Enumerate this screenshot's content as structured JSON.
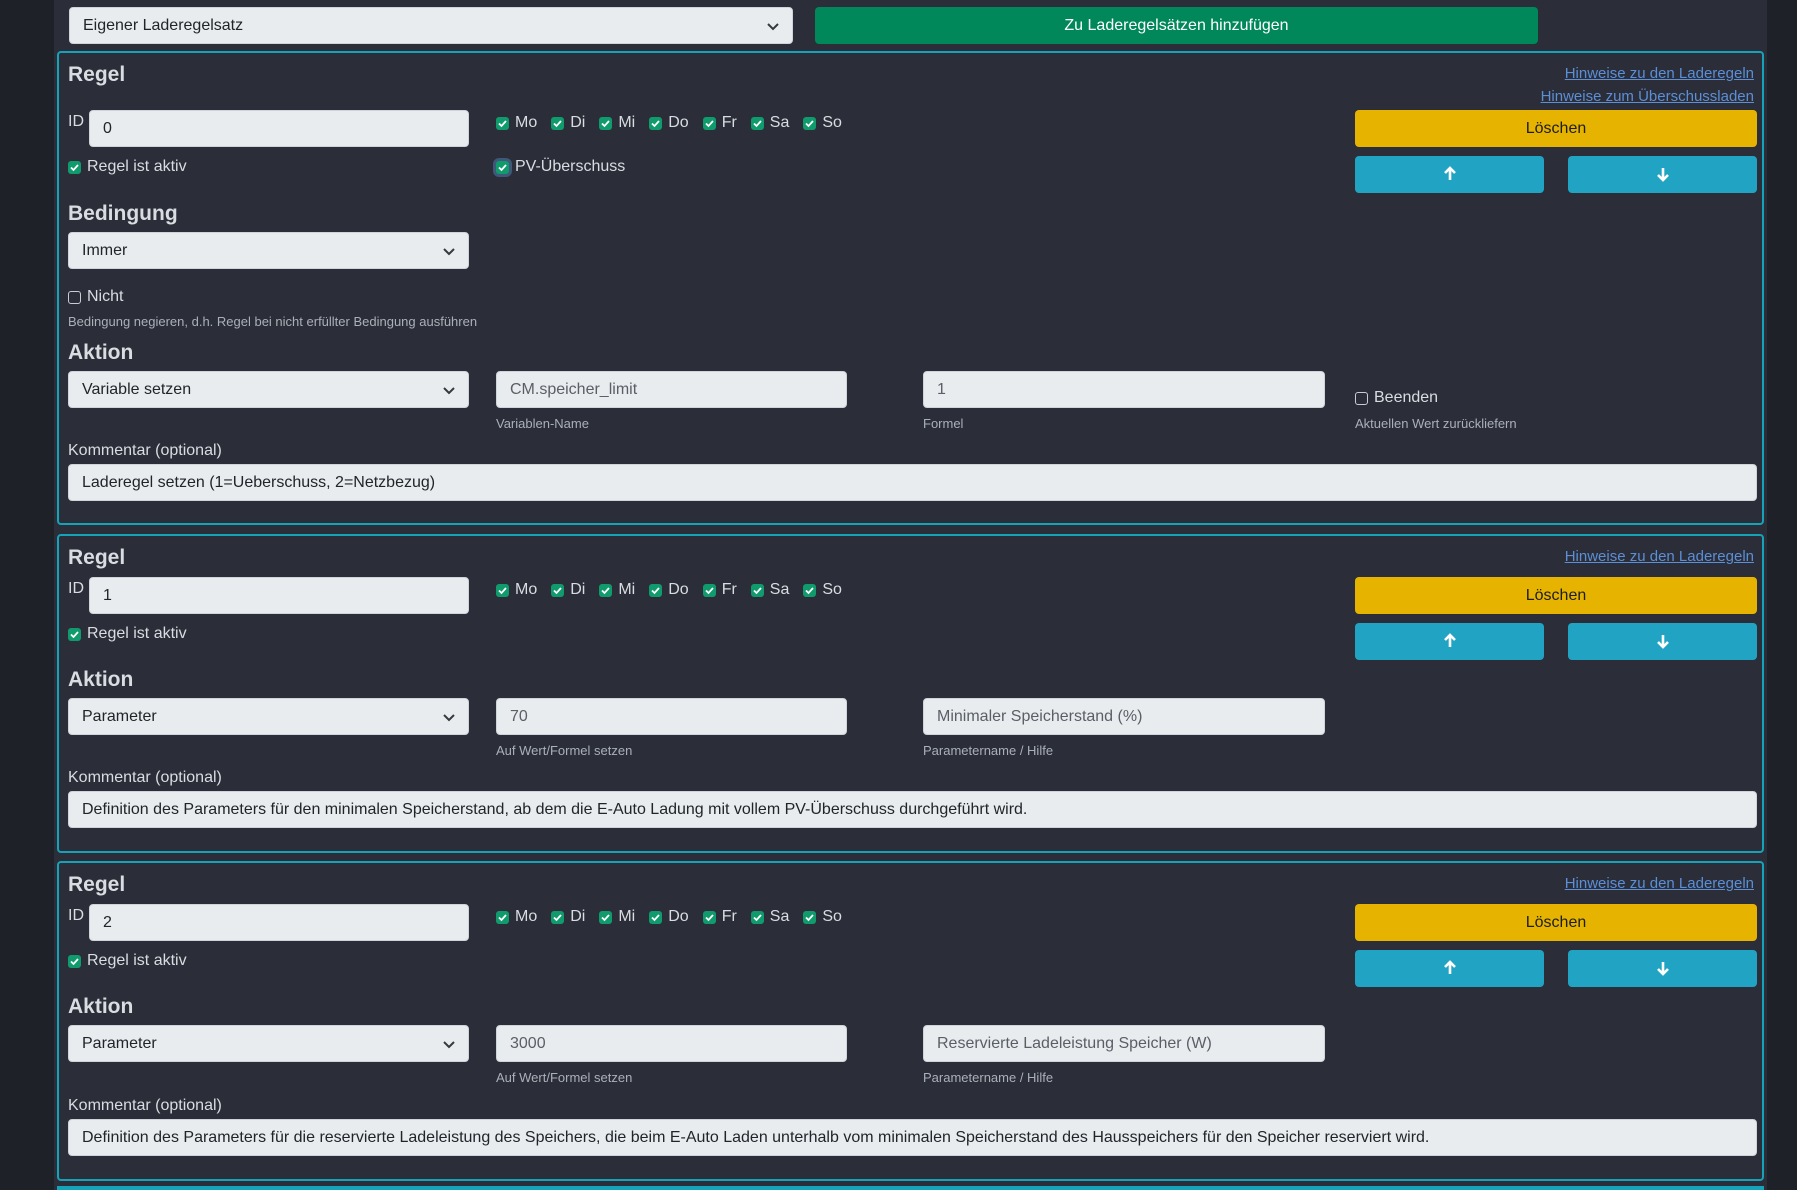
{
  "top": {
    "ruleset_select": "Eigener Laderegelsatz",
    "add_button": "Zu Laderegelsätzen hinzufügen"
  },
  "rules": [
    {
      "title": "Regel",
      "links": [
        "Hinweise zu den Laderegeln",
        "Hinweise zum Überschussladen"
      ],
      "id_label": "ID",
      "id_value": "0",
      "days": [
        "Mo",
        "Di",
        "Mi",
        "Do",
        "Fr",
        "Sa",
        "So"
      ],
      "active_label": "Regel ist aktiv",
      "pv_label": "PV-Überschuss",
      "delete_label": "Löschen",
      "condition_title": "Bedingung",
      "condition_select": "Immer",
      "not_label": "Nicht",
      "not_help": "Bedingung negieren, d.h. Regel bei nicht erfüllter Bedingung ausführen",
      "action_title": "Aktion",
      "action_select": "Variable setzen",
      "field1_value": "CM.speicher_limit",
      "field1_help": "Variablen-Name",
      "field2_value": "1",
      "field2_help": "Formel",
      "end_label": "Beenden",
      "end_help": "Aktuellen Wert zurückliefern",
      "comment_label": "Kommentar (optional)",
      "comment_value": "Laderegel setzen (1=Ueberschuss, 2=Netzbezug)"
    },
    {
      "title": "Regel",
      "links": [
        "Hinweise zu den Laderegeln"
      ],
      "id_label": "ID",
      "id_value": "1",
      "days": [
        "Mo",
        "Di",
        "Mi",
        "Do",
        "Fr",
        "Sa",
        "So"
      ],
      "active_label": "Regel ist aktiv",
      "delete_label": "Löschen",
      "action_title": "Aktion",
      "action_select": "Parameter",
      "field1_value": "70",
      "field1_help": "Auf Wert/Formel setzen",
      "field2_value": "Minimaler Speicherstand (%)",
      "field2_help": "Parametername / Hilfe",
      "comment_label": "Kommentar (optional)",
      "comment_value": "Definition des Parameters für den minimalen Speicherstand, ab dem die E-Auto Ladung mit vollem PV-Überschuss durchgeführt wird."
    },
    {
      "title": "Regel",
      "links": [
        "Hinweise zu den Laderegeln"
      ],
      "id_label": "ID",
      "id_value": "2",
      "days": [
        "Mo",
        "Di",
        "Mi",
        "Do",
        "Fr",
        "Sa",
        "So"
      ],
      "active_label": "Regel ist aktiv",
      "delete_label": "Löschen",
      "action_title": "Aktion",
      "action_select": "Parameter",
      "field1_value": "3000",
      "field1_help": "Auf Wert/Formel setzen",
      "field2_value": "Reservierte Ladeleistung Speicher (W)",
      "field2_help": "Parametername / Hilfe",
      "comment_label": "Kommentar (optional)",
      "comment_value": "Definition des Parameters für die reservierte Ladeleistung des Speichers, die beim E-Auto Laden unterhalb vom minimalen Speicherstand des Hausspeichers für den Speicher reserviert wird."
    }
  ],
  "colors": {
    "background": "#2b2d38",
    "card_border": "#14a3b8",
    "success": "#00875a",
    "warning": "#e6b400",
    "info": "#21a4c3",
    "link": "#5b8fd6",
    "check": "#0f9b6c"
  },
  "icons": {
    "select_chevron": "chevron-down-icon",
    "move_up": "arrow-up-icon",
    "move_down": "arrow-down-icon",
    "checkbox": "check-icon"
  }
}
